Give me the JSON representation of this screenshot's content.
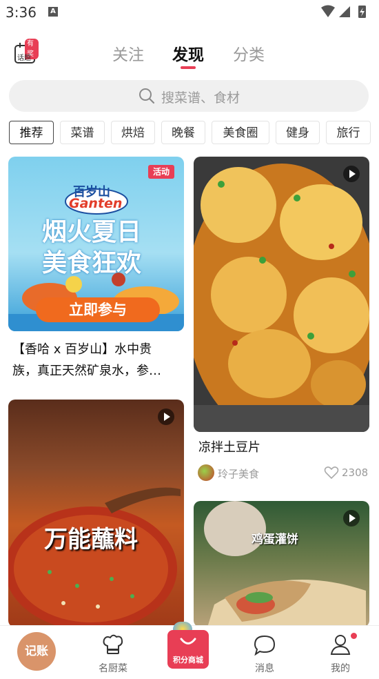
{
  "status_bar": {
    "time": "3:36",
    "notif_icon": "A"
  },
  "header": {
    "topic_badge": "有奖",
    "topic_label": "话题",
    "tabs": [
      {
        "label": "关注",
        "active": false
      },
      {
        "label": "发现",
        "active": true
      },
      {
        "label": "分类",
        "active": false
      }
    ],
    "accent_color": "#e83e55"
  },
  "search": {
    "placeholder": "搜菜谱、食材"
  },
  "categories": [
    "推荐",
    "菜谱",
    "烘焙",
    "晚餐",
    "美食圈",
    "健身",
    "旅行"
  ],
  "feed": {
    "left": [
      {
        "type": "promo",
        "badge": "活动",
        "brand": "百岁山",
        "brand_logo": "Ganten",
        "headline_1": "烟火夏日",
        "headline_2": "美食狂欢",
        "cta": "立即参与",
        "title_line1": "【香哈 x 百岁山】水中贵",
        "title_line2": "族，真正天然矿泉水，参…"
      },
      {
        "type": "video",
        "overlay_text": "万能蘸料"
      }
    ],
    "right": [
      {
        "type": "video",
        "title": "凉拌土豆片",
        "author": "玲子美食",
        "likes": "2308"
      },
      {
        "type": "video",
        "overlay_text": "鸡蛋灌饼"
      }
    ]
  },
  "bottom_nav": {
    "bookkeeping": "记账",
    "chef": "名厨菜",
    "mall": "积分商城",
    "messages": "消息",
    "mine": "我的"
  }
}
